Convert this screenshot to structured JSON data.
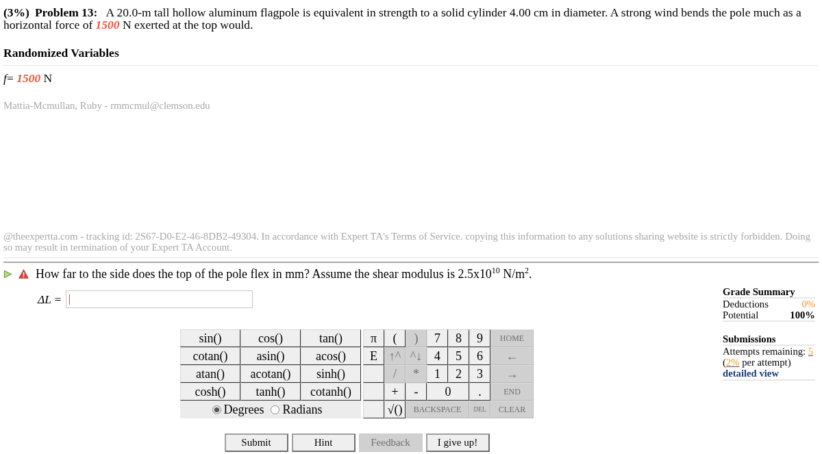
{
  "problem": {
    "weight": "(3%)",
    "title": "Problem 13:",
    "statement": "A 20.0-m tall hollow aluminum flagpole is equivalent in strength to a solid cylinder 4.00 cm in diameter. A strong wind bends the pole much as a horizontal force of **1500** N exerted at the top would."
  },
  "randomized_variables": {
    "title": "Randomized Variables",
    "items": [
      "*f*= **1500** N"
    ]
  },
  "student": "Mattia-Mcmullan, Ruby - rmmcmul@clemson.edu",
  "tracking_notice": "@theexpertta.com - tracking id: 2S67-D0-E2-46-8DB2-49304. In accordance with Expert TA's Terms of Service. copying this information to any solutions sharing website is strictly forbidden. Doing so may result in termination of your Expert TA Account.",
  "question": {
    "text": "How far to the side does the top of the pole flex in mm? Assume the shear modulus is 2.5x10$^{10}$ N/m$^{2}$.",
    "answer_label": "*ΔL* =",
    "answer_focused": true
  },
  "calculator": {
    "functions": [
      "sin()",
      "cos()",
      "tan()",
      "cotan()",
      "asin()",
      "acos()",
      "atan()",
      "acotan()",
      "sinh()",
      "cosh()",
      "tanh()",
      "cotanh()"
    ],
    "angle_modes": [
      {
        "label": "Degrees",
        "selected": true
      },
      {
        "label": "Radians",
        "selected": false
      }
    ],
    "key_rows": [
      [
        {
          "kind": "key",
          "label": "π",
          "disabled": false
        },
        {
          "kind": "key",
          "label": "(",
          "disabled": false
        },
        {
          "kind": "key",
          "label": ")",
          "disabled": true
        },
        {
          "kind": "key",
          "label": "7",
          "disabled": false
        },
        {
          "kind": "key",
          "label": "8",
          "disabled": false
        },
        {
          "kind": "key",
          "label": "9",
          "disabled": false
        },
        {
          "kind": "command",
          "label": "HOME",
          "disabled": true
        }
      ],
      [
        {
          "kind": "key",
          "label": "E",
          "disabled": false
        },
        {
          "kind": "key",
          "label": "↑^",
          "disabled": true
        },
        {
          "kind": "key",
          "label": "^↓",
          "disabled": true
        },
        {
          "kind": "key",
          "label": "4",
          "disabled": false
        },
        {
          "kind": "key",
          "label": "5",
          "disabled": false
        },
        {
          "kind": "key",
          "label": "6",
          "disabled": false
        },
        {
          "kind": "key",
          "label": "←",
          "disabled": true
        }
      ],
      [
        {
          "kind": "blank"
        },
        {
          "kind": "key",
          "label": "/",
          "disabled": true
        },
        {
          "kind": "key",
          "label": "*",
          "disabled": true
        },
        {
          "kind": "key",
          "label": "1",
          "disabled": false
        },
        {
          "kind": "key",
          "label": "2",
          "disabled": false
        },
        {
          "kind": "key",
          "label": "3",
          "disabled": false
        },
        {
          "kind": "key",
          "label": "→",
          "disabled": true
        }
      ],
      [
        {
          "kind": "blank"
        },
        {
          "kind": "key",
          "label": "+",
          "disabled": false
        },
        {
          "kind": "key",
          "label": "-",
          "disabled": false
        },
        {
          "kind": "wide-key",
          "label": "0",
          "disabled": false
        },
        {
          "kind": "key",
          "label": ".",
          "disabled": false
        },
        {
          "kind": "command",
          "label": "END",
          "disabled": true
        }
      ],
      [
        {
          "kind": "blank"
        },
        {
          "kind": "key",
          "label": "√()",
          "disabled": false
        },
        {
          "kind": "wide-command",
          "label": "BACKSPACE",
          "disabled": true
        },
        {
          "kind": "tiny-command",
          "label": "DEL",
          "disabled": true
        },
        {
          "kind": "command",
          "label": "CLEAR",
          "disabled": true
        }
      ]
    ]
  },
  "actions": [
    {
      "label": "Submit",
      "disabled": false
    },
    {
      "label": "Hint",
      "disabled": false
    },
    {
      "label": "Feedback",
      "disabled": true
    },
    {
      "label": "I give up!",
      "disabled": false
    }
  ],
  "grade_summary": {
    "title": "Grade Summary",
    "rows": [
      {
        "kind": "deduction",
        "label": "Deductions",
        "value": "0%"
      },
      {
        "kind": "potential",
        "label": "Potential",
        "value": "100%"
      }
    ]
  },
  "submissions": {
    "title": "Submissions",
    "lines": [
      "Attempts remaining: **5**",
      "(**2%** per attempt)"
    ],
    "link": "detailed view"
  }
}
